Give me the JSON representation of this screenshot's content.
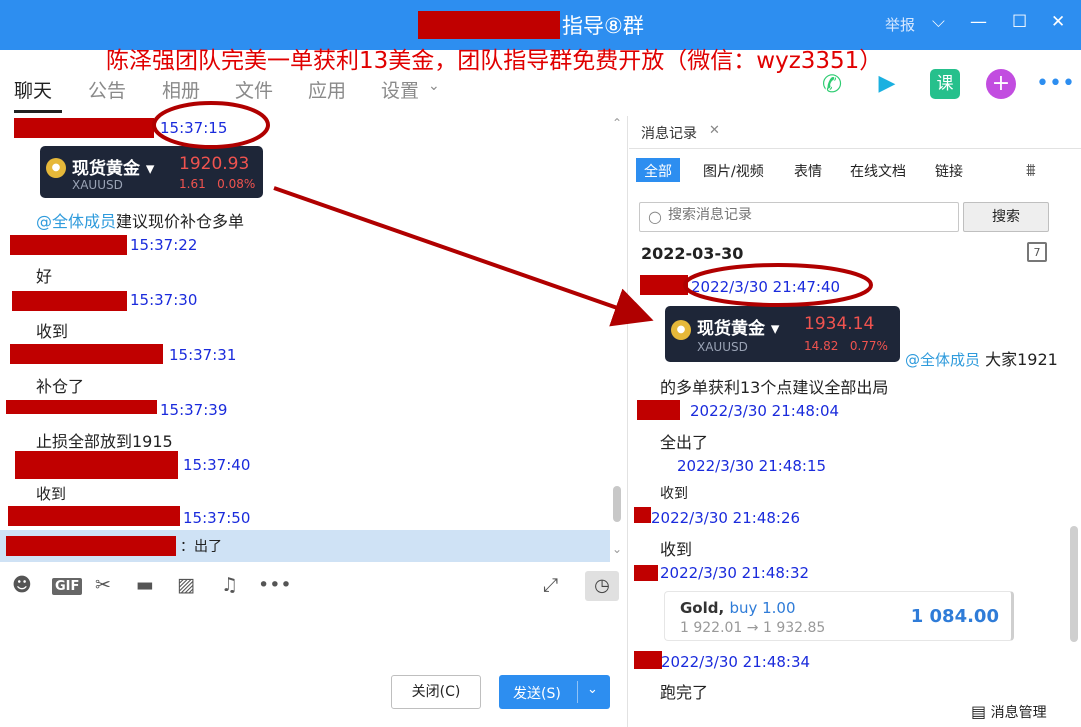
{
  "window": {
    "title_suffix": "指导⑧群",
    "report_label": "举报",
    "min_icon": "minimize-icon",
    "max_icon": "maximize-icon",
    "close_icon": "close-icon"
  },
  "banner": "陈泽强团队完美一单获利13美金，团队指导群免费开放（微信：wyz3351）",
  "tabs": [
    "聊天",
    "公告",
    "相册",
    "文件",
    "应用",
    "设置"
  ],
  "active_tab": "聊天",
  "top_icons": [
    "phone-icon",
    "video-icon",
    "course-icon",
    "plus-icon",
    "more-icon"
  ],
  "top_icon_labels": {
    "course": "课"
  },
  "chat": {
    "messages": [
      {
        "time": "15:37:15"
      },
      {
        "card": {
          "name": "现货黄金",
          "symbol": "XAUUSD",
          "price": "1920.93",
          "change": "1.61",
          "change_pct": "0.08%"
        }
      },
      {
        "mention": "@全体成员",
        "text": "建议现价补仓多单"
      },
      {
        "time": "15:37:22",
        "text": "好"
      },
      {
        "time": "15:37:30",
        "text": "收到"
      },
      {
        "time": "15:37:31",
        "text": "补仓了"
      },
      {
        "time": "15:37:39",
        "text": "止损全部放到1915"
      },
      {
        "time": "15:37:40",
        "text": "收到"
      },
      {
        "time": "15:37:50",
        "text": "：出了"
      }
    ]
  },
  "composer": {
    "close_label": "关闭(C)",
    "send_label": "发送(S)",
    "gif_label": "GIF"
  },
  "history": {
    "tab_label": "消息记录",
    "filters": [
      "全部",
      "图片/视频",
      "表情",
      "在线文档",
      "链接"
    ],
    "active_filter": "全部",
    "search_placeholder": "搜索消息记录",
    "search_button": "搜索",
    "date": "2022-03-30",
    "calendar_day": "7",
    "entries": [
      {
        "time": "2022/3/30 21:47:40"
      },
      {
        "card": {
          "name": "现货黄金",
          "symbol": "XAUUSD",
          "price": "1934.14",
          "change": "14.82",
          "change_pct": "0.77%"
        }
      },
      {
        "mention": "@全体成员",
        "text": "大家1921"
      },
      {
        "text": "的多单获利13个点建议全部出局"
      },
      {
        "time": "2022/3/30 21:48:04",
        "text": "全出了"
      },
      {
        "time": "2022/3/30 21:48:15",
        "text": "收到"
      },
      {
        "time": "2022/3/30 21:48:26",
        "text": "收到"
      },
      {
        "time": "2022/3/30 21:48:32"
      },
      {
        "trade": {
          "instrument": "Gold,",
          "side": "buy 1.00",
          "from": "1 922.01",
          "arrow": "→",
          "to": "1 932.85",
          "profit": "1 084.00"
        }
      },
      {
        "time": "2022/3/30 21:48:34",
        "text": "跑完了"
      }
    ],
    "manage_label": "消息管理"
  },
  "colors": {
    "titlebar": "#2d8ef0",
    "redaction": "#c00000",
    "timestamp": "#1a2bdc",
    "banner": "#e00000",
    "annotation": "#b00000",
    "card_bg": "#1e2638",
    "price_red": "#f0534f"
  }
}
